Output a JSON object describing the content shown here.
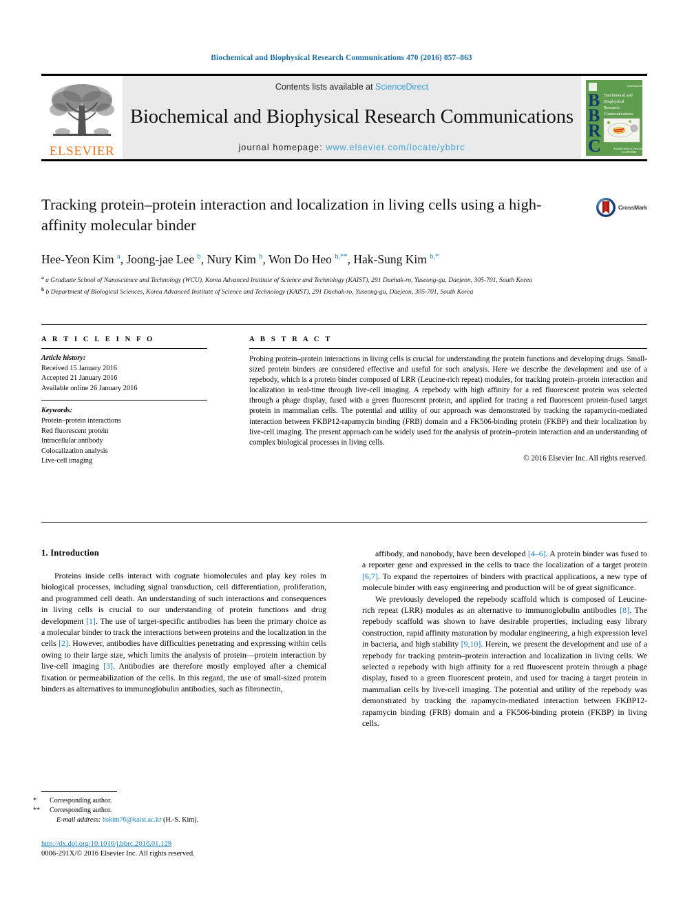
{
  "running_head": "Biochemical and Biophysical Research Communications 470 (2016) 857–863",
  "masthead": {
    "contents_prefix": "Contents lists available at ",
    "contents_link": "ScienceDirect",
    "journal_title": "Biochemical and Biophysical Research Communications",
    "homepage_prefix": "journal homepage: ",
    "homepage_link": "www.elsevier.com/locate/ybbrc",
    "publisher_wordmark": "ELSEVIER",
    "cover": {
      "letters": "BBRC",
      "cover_title_lines": [
        "Biochemical and",
        "Biophysical",
        "Research",
        "Communications"
      ],
      "footer_text": "ELSEVIER"
    }
  },
  "article": {
    "title": "Tracking protein–protein interaction and localization in living cells using a high-affinity molecular binder",
    "crossmark_label": "CrossMark",
    "authors_html": "Hee-Yeon Kim <sup>a</sup>, Joong-jae Lee <sup>b</sup>, Nury Kim <sup>b</sup>, Won Do Heo <sup>b,**</sup>, Hak-Sung Kim <sup>b,*</sup>",
    "affiliations": [
      "a Graduate School of Nanoscience and Technology (WCU), Korea Advanced Institute of Science and Technology (KAIST), 291 Daehak-ro, Yuseong-gu, Daejeon, 305-701, South Korea",
      "b Department of Biological Sciences, Korea Advanced Institute of Science and Technology (KAIST), 291 Daehak-ro, Yuseong-gu, Daejeon, 305-701, South Korea"
    ]
  },
  "article_info": {
    "heading": "A R T I C L E   I N F O",
    "history_label": "Article history:",
    "history": [
      "Received 15 January 2016",
      "Accepted 21 January 2016",
      "Available online 26 January 2016"
    ],
    "keywords_label": "Keywords:",
    "keywords": [
      "Protein–protein interactions",
      "Red fluorescent protein",
      "Intracellular antibody",
      "Colocalization analysis",
      "Live-cell imaging"
    ]
  },
  "abstract": {
    "heading": "A B S T R A C T",
    "text": "Probing protein–protein interactions in living cells is crucial for understanding the protein functions and developing drugs. Small-sized protein binders are considered effective and useful for such analysis. Here we describe the development and use of a repebody, which is a protein binder composed of LRR (Leucine-rich repeat) modules, for tracking protein–protein interaction and localization in real-time through live-cell imaging. A repebody with high affinity for a red fluorescent protein was selected through a phage display, fused with a green fluorescent protein, and applied for tracing a red fluorescent protein-fused target protein in mammalian cells. The potential and utility of our approach was demonstrated by tracking the rapamycin-mediated interaction between FKBP12-rapamycin binding (FRB) domain and a FK506-binding protein (FKBP) and their localization by live-cell imaging. The present approach can be widely used for the analysis of protein–protein interaction and an understanding of complex biological processes in living cells.",
    "copyright": "© 2016 Elsevier Inc. All rights reserved."
  },
  "introduction": {
    "heading": "1. Introduction",
    "left_paragraph_html": "Proteins inside cells interact with cognate biomolecules and play key roles in biological processes, including signal transduction, cell differentiation, proliferation, and programmed cell death. An understanding of such interactions and consequences in living cells is crucial to our understanding of protein functions and drug development <span class=\"ref\">[1]</span>. The use of target-specific antibodies has been the primary choice as a molecular binder to track the interactions between proteins and the localization in the cells <span class=\"ref\">[2]</span>. However, antibodies have difficulties penetrating and expressing within cells owing to their large size, which limits the analysis of protein––protein interaction by live-cell imaging <span class=\"ref\">[3]</span>. Antibodies are therefore mostly employed after a chemical fixation or permeabilization of the cells. In this regard, the use of small-sized protein binders as alternatives to immunoglobulin antibodies, such as fibronectin,",
    "right_paragraph1_html": "affibody, and nanobody, have been developed <span class=\"ref\">[4–6]</span>. A protein binder was fused to a reporter gene and expressed in the cells to trace the localization of a target protein <span class=\"ref\">[6,7]</span>. To expand the repertoires of binders with practical applications, a new type of molecule binder with easy engineering and production will be of great significance.",
    "right_paragraph2_html": "We previously developed the repebody scaffold which is composed of Leucine-rich repeat (LRR) modules as an alternative to immunoglobulin antibodies <span class=\"ref\">[8]</span>. The repebody scaffold was shown to have desirable properties, including easy library construction, rapid affinity maturation by modular engineering, a high expression level in bacteria, and high stability <span class=\"ref\">[9,10]</span>. Herein, we present the development and use of a repebody for tracking protein–protein interaction and localization in living cells. We selected a repebody with high affinity for a red fluorescent protein through a phage display, fused to a green fluorescent protein, and used for tracing a target protein in mammalian cells by live-cell imaging. The potential and utility of the repebody was demonstrated by tracking the rapamycin-mediated interaction between FKBP12-rapamycin binding (FRB) domain and a FK506-binding protein (FKBP) in living cells."
  },
  "footnotes": {
    "corresponding1": "Corresponding author.",
    "corresponding2": "Corresponding author.",
    "email_label": "E-mail address:",
    "email": "hskim76@kaist.ac.kr",
    "email_suffix": "(H.-S. Kim).",
    "doi": "http://dx.doi.org/10.1016/j.bbrc.2016.01.129",
    "issn_line": "0006-291X/© 2016 Elsevier Inc. All rights reserved."
  },
  "colors": {
    "link_blue": "#1a7fc1",
    "sciencedirect_blue": "#3a9fd6",
    "elsevier_orange": "#E87722",
    "cover_green": "#5f9e4f",
    "masthead_gray": "#eaeaea"
  }
}
